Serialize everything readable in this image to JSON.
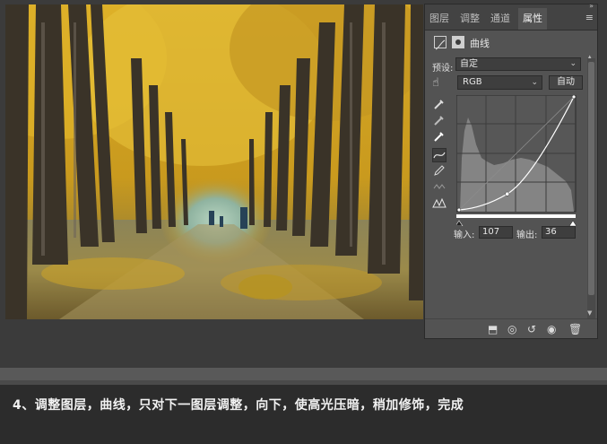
{
  "panel": {
    "tabs": [
      {
        "label": "图层"
      },
      {
        "label": "调整"
      },
      {
        "label": "通道"
      },
      {
        "label": "属性"
      }
    ],
    "active_tab": 3,
    "title": "曲线",
    "preset_label": "预设:",
    "preset_value": "自定",
    "channel_value": "RGB",
    "auto_label": "自动",
    "input_label": "输入:",
    "input_value": "107",
    "output_label": "输出:",
    "output_value": "36",
    "icons": {
      "menu": "hamburger-icon",
      "collapse": "double-chevron-icon",
      "curves": "curves-adjustment-icon",
      "mask": "layer-mask-icon",
      "hand": "on-image-adjust-icon",
      "eyedroppers": [
        "black-point-eyedropper-icon",
        "gray-point-eyedropper-icon",
        "white-point-eyedropper-icon"
      ],
      "tools": [
        "edit-points-icon",
        "pencil-icon",
        "smooth-icon",
        "clipping-warning-icon"
      ],
      "bottom": [
        "clip-to-layer-icon",
        "view-previous-icon",
        "reset-icon",
        "visibility-eye-icon",
        "trash-icon"
      ]
    }
  },
  "curve": {
    "input": 107,
    "output": 36,
    "endpoints": [
      [
        0,
        0
      ],
      [
        255,
        255
      ]
    ]
  },
  "colors": {
    "panel_bg": "#535353",
    "canvas_bg": "#3b3b3b",
    "caption_bg": "#2c2c2c",
    "foliage": "#d9a81c"
  },
  "caption": {
    "text": "4、调整图层，曲线，只对下一图层调整，向下，使高光压暗，稍加修饰，完成"
  }
}
